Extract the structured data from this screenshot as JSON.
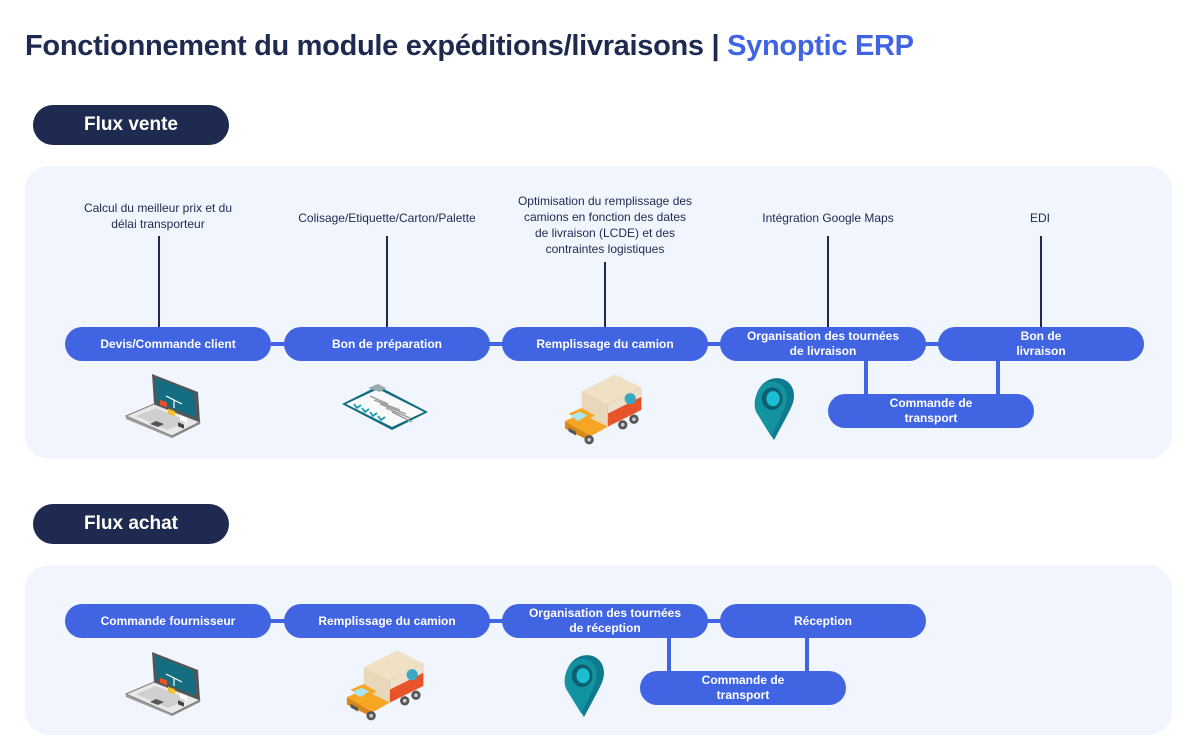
{
  "header": {
    "title": "Fonctionnement du module expéditions/livraisons",
    "separator": "|",
    "brand": "Synoptic ERP"
  },
  "colors": {
    "navy": "#1e2a4f",
    "accent": "#4164e3",
    "panel_bg": "#f0f5fe"
  },
  "flux_vente": {
    "label": "Flux vente",
    "steps": [
      {
        "label": "Devis/Commande client",
        "feature": "Calcul du meilleur prix et du délai transporteur",
        "icon": "laptop-icon"
      },
      {
        "label": "Bon de préparation",
        "feature": "Colisage/Etiquette/Carton/Palette",
        "icon": "clipboard-checklist-icon"
      },
      {
        "label": "Remplissage du camion",
        "feature": "Optimisation du remplissage des camions en fonction des dates de livraison (LCDE) et des contraintes logistiques",
        "icon": "delivery-truck-icon"
      },
      {
        "label": "Organisation des tournées de livraison",
        "feature": "Intégration Google Maps",
        "icon": "map-pin-icon"
      },
      {
        "label": "Bon de livraison",
        "feature": "EDI"
      }
    ],
    "sub_step": {
      "label": "Commande de transport"
    }
  },
  "flux_achat": {
    "label": "Flux achat",
    "steps": [
      {
        "label": "Commande fournisseur",
        "icon": "laptop-icon"
      },
      {
        "label": "Remplissage du camion",
        "icon": "delivery-truck-icon"
      },
      {
        "label": "Organisation des tournées de réception",
        "icon": "map-pin-icon"
      },
      {
        "label": "Réception"
      }
    ],
    "sub_step": {
      "label": "Commande de transport"
    }
  }
}
